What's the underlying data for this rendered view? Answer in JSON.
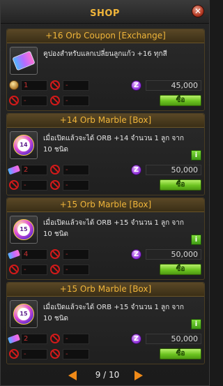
{
  "header": {
    "title": "SHOP",
    "close_label": "✕"
  },
  "items": [
    {
      "title": "+16 Orb Coupon [Exchange]",
      "icon": "orb-coupon-ticket-icon",
      "icon_label": "",
      "description": "คูปองสำหรับแลกเปลี่ยนลูกแก้ว +16 ทุกสี",
      "show_info": false,
      "cost_icon": "coin-icon",
      "qty": "1",
      "slot2": "-",
      "slot3": "-",
      "slot4": "-",
      "price": "45,000",
      "buy_label": "ซื้อ"
    },
    {
      "title": "+14 Orb Marble [Box]",
      "icon": "orb-marble-14-icon",
      "icon_label": "14",
      "description": "เมื่อเปิดแล้วจะได้ ORB +14 จำนวน 1 ลูก จาก 10 ชนิด",
      "show_info": true,
      "cost_icon": "ticket-icon",
      "qty": "2",
      "slot2": "-",
      "slot3": "-",
      "slot4": "-",
      "price": "50,000",
      "buy_label": "ซื้อ"
    },
    {
      "title": "+15 Orb Marble [Box]",
      "icon": "orb-marble-15-icon",
      "icon_label": "15",
      "description": "เมื่อเปิดแล้วจะได้ ORB +15 จำนวน 1 ลูก จาก 10 ชนิด",
      "show_info": true,
      "cost_icon": "ticket-icon",
      "qty": "4",
      "slot2": "-",
      "slot3": "-",
      "slot4": "-",
      "price": "50,000",
      "buy_label": "ซื้อ"
    },
    {
      "title": "+15 Orb Marble [Box]",
      "icon": "orb-marble-15-icon",
      "icon_label": "15",
      "description": "เมื่อเปิดแล้วจะได้ ORB +15 จำนวน 1 ลูก จาก 10 ชนิด",
      "show_info": true,
      "cost_icon": "ticket-icon",
      "qty": "2",
      "slot2": "-",
      "slot3": "-",
      "slot4": "-",
      "price": "50,000",
      "buy_label": "ซื้อ"
    }
  ],
  "info_label": "i",
  "currency_label": "Z",
  "pager": {
    "text": "9 / 10"
  },
  "colors": {
    "accent": "#f0b53a",
    "buy": "#6cc320",
    "no": "#d21a1a"
  }
}
